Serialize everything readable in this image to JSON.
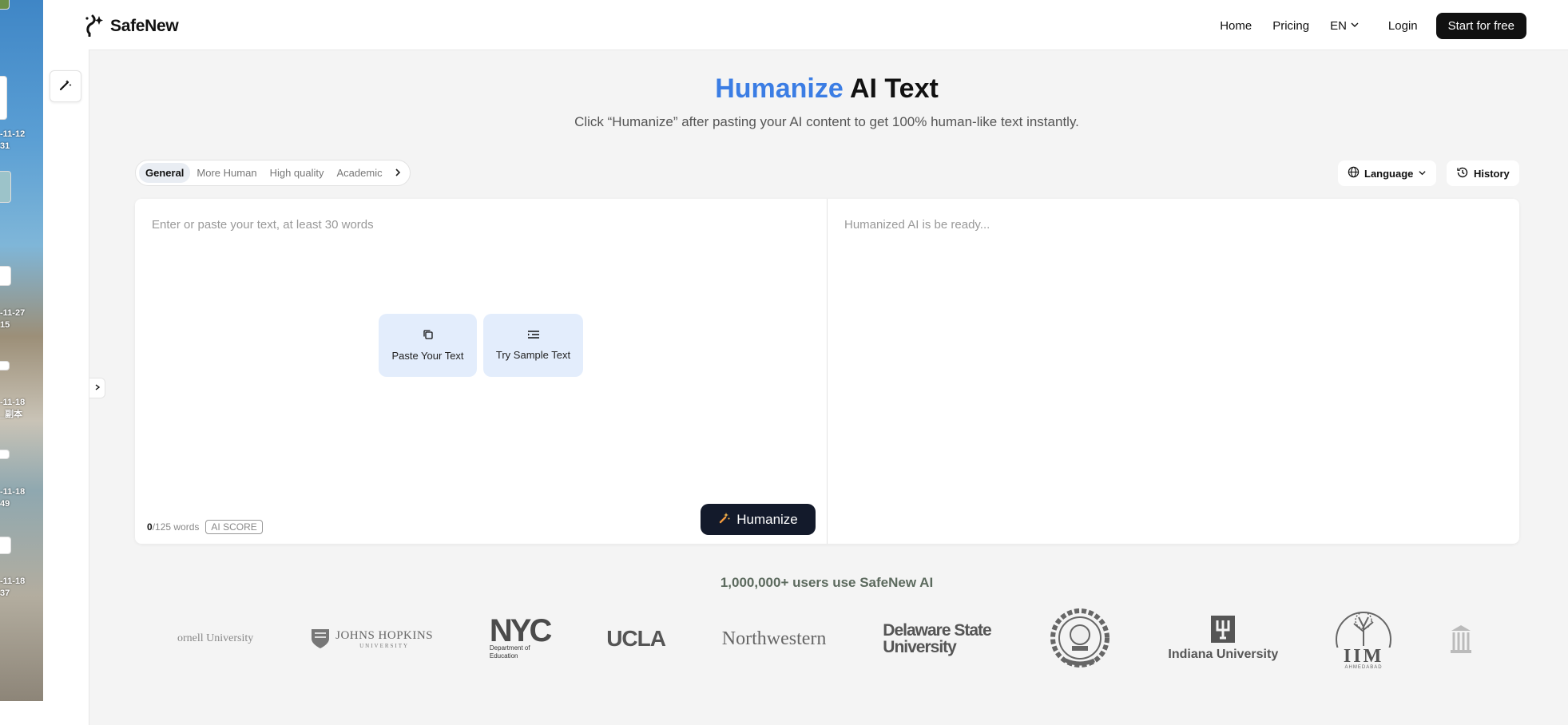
{
  "desktop": {
    "labels": [
      "-11-12\n31",
      "-11-27\n15",
      "-11-18\n_副本",
      "-11-18\n49",
      "-11-18\n37"
    ]
  },
  "header": {
    "brand": "SafeNew",
    "nav": {
      "home": "Home",
      "pricing": "Pricing",
      "lang": "EN",
      "login": "Login",
      "start": "Start for free"
    }
  },
  "hero": {
    "title_accent": "Humanize",
    "title_rest": " AI Text",
    "subtitle": "Click “Humanize” after pasting your AI content to get 100% human-like text instantly."
  },
  "modes": {
    "tabs": [
      "General",
      "More Human",
      "High quality",
      "Academic"
    ],
    "active": "General"
  },
  "toolbar": {
    "language": "Language",
    "history": "History"
  },
  "editor": {
    "input_placeholder": "Enter or paste your text, at least 30 words",
    "output_placeholder": "Humanized AI is be ready...",
    "paste_label": "Paste Your Text",
    "sample_label": "Try Sample Text",
    "word_count": "0",
    "word_limit": "/125 words",
    "ai_score": "AI SCORE",
    "humanize_label": "Humanize"
  },
  "social_proof": {
    "users_text": "1,000,000+ users use SafeNew AI",
    "logos": {
      "cornell": "ornell University",
      "jhu": "Johns Hopkins",
      "jhu_sub": "UNIVERSITY",
      "nyc": "NYC",
      "nyc_sub1": "Department of",
      "nyc_sub2": "Education",
      "ucla": "UCLA",
      "northwestern": "Northwestern",
      "delaware1": "Delaware State",
      "delaware2": "University",
      "indiana": "Indiana University",
      "iim": "IIM",
      "iim_sub": "AHMEDABAD"
    }
  },
  "colors": {
    "accent": "#3b7de4",
    "dark_button": "#111111",
    "card_bg": "#e3edfc"
  }
}
